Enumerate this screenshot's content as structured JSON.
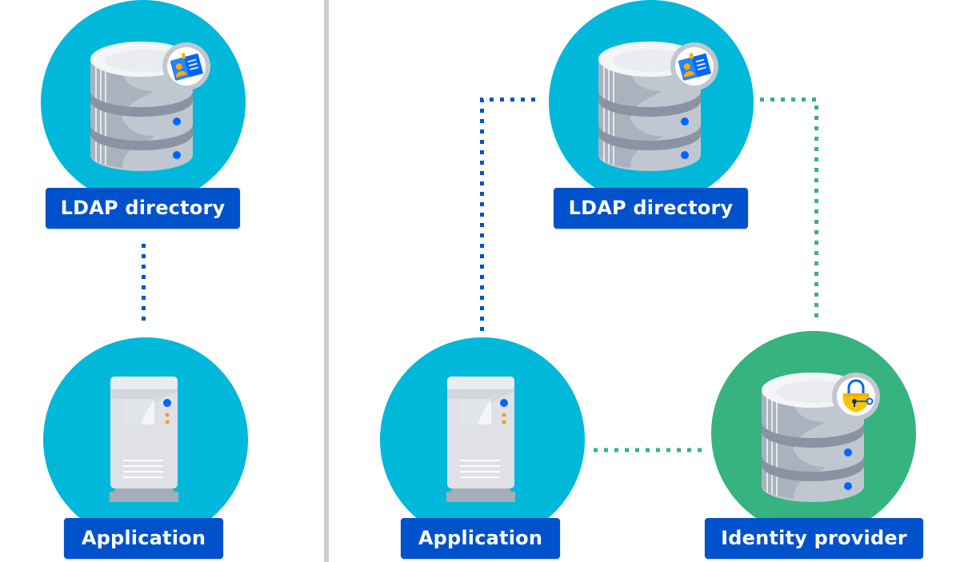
{
  "diagram": {
    "colors": {
      "app_circle": "#00b8d9",
      "idp_circle": "#36b37e",
      "label_bg": "#0052cc",
      "label_text": "#ffffff",
      "link_blue": "#0052cc",
      "link_green": "#36b37e",
      "divider": "#cccccc"
    },
    "left_panel": {
      "ldap": {
        "label": "LDAP directory",
        "icon": "database-with-id-card"
      },
      "app": {
        "label": "Application",
        "icon": "server-tower"
      },
      "links": [
        {
          "from": "LDAP directory",
          "to": "Application",
          "style": "dotted",
          "color": "blue"
        }
      ]
    },
    "right_panel": {
      "ldap": {
        "label": "LDAP directory",
        "icon": "database-with-id-card"
      },
      "app": {
        "label": "Application",
        "icon": "server-tower"
      },
      "idp": {
        "label": "Identity provider",
        "icon": "database-with-padlock"
      },
      "links": [
        {
          "from": "Application",
          "to": "LDAP directory",
          "style": "dotted",
          "color": "blue"
        },
        {
          "from": "LDAP directory",
          "to": "Identity provider",
          "style": "dotted",
          "color": "green"
        },
        {
          "from": "Application",
          "to": "Identity provider",
          "style": "dotted",
          "color": "green"
        }
      ]
    }
  }
}
